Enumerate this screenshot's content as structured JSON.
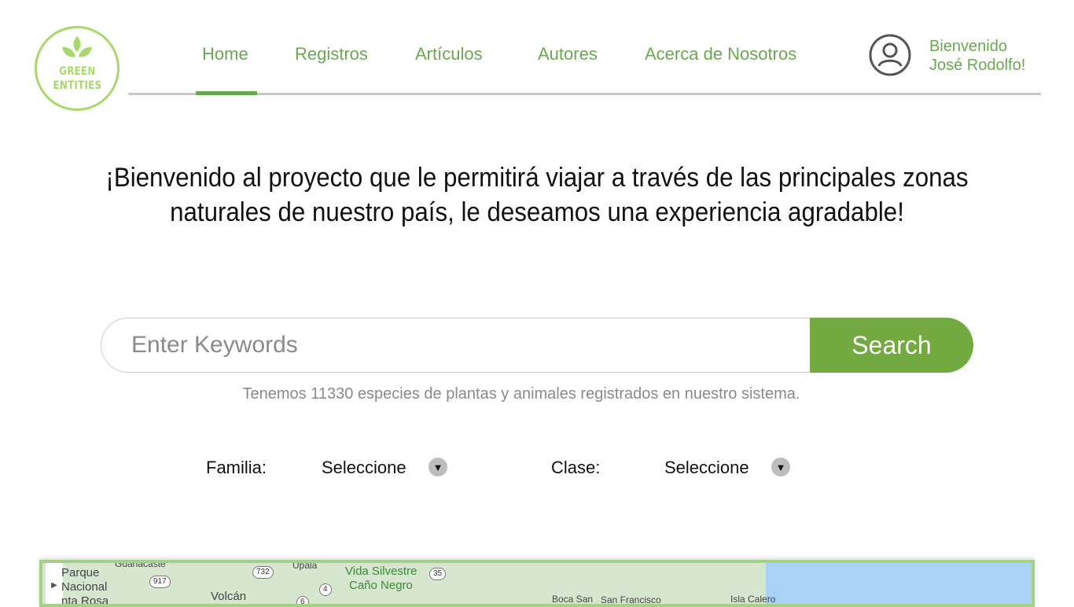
{
  "logo": {
    "line1": "GREEN",
    "line2": "ENTITIES"
  },
  "nav": {
    "home": "Home",
    "registros": "Registros",
    "articulos": "Artículos",
    "autores": "Autores",
    "acerca": "Acerca de Nosotros"
  },
  "user": {
    "greeting": "Bienvenido",
    "name": "José Rodolfo!"
  },
  "hero": {
    "line1": "¡Bienvenido al proyecto que le permitirá viajar a través de las principales zonas",
    "line2": "naturales de nuestro país, le deseamos una experiencia agradable!"
  },
  "search": {
    "placeholder": "Enter Keywords",
    "button": "Search"
  },
  "species_note": "Tenemos 11330 especies de plantas y animales registrados en nuestro sistema.",
  "filters": {
    "familia": {
      "label": "Familia:",
      "value": "Seleccione"
    },
    "clase": {
      "label": "Clase:",
      "value": "Seleccione"
    }
  },
  "map": {
    "labels": {
      "parque": "Parque",
      "nacional": "Nacional",
      "santa_rosa": "nta Rosa",
      "guanacaste": "Guanacaste",
      "upala": "Upala",
      "vida_silvestre": "Vida Silvestre",
      "cano_negro": "Caño Negro",
      "volcan": "Volcán",
      "boca_san": "Boca San",
      "san_francisco": "San Francisco",
      "isla_calero": "Isla Calero"
    },
    "roads": {
      "r917": "917",
      "r732": "732",
      "r4": "4",
      "r35": "35",
      "r6": "6"
    }
  },
  "colors": {
    "accent": "#6aa84f",
    "button": "#72aa41",
    "logo": "#a8d86a"
  }
}
